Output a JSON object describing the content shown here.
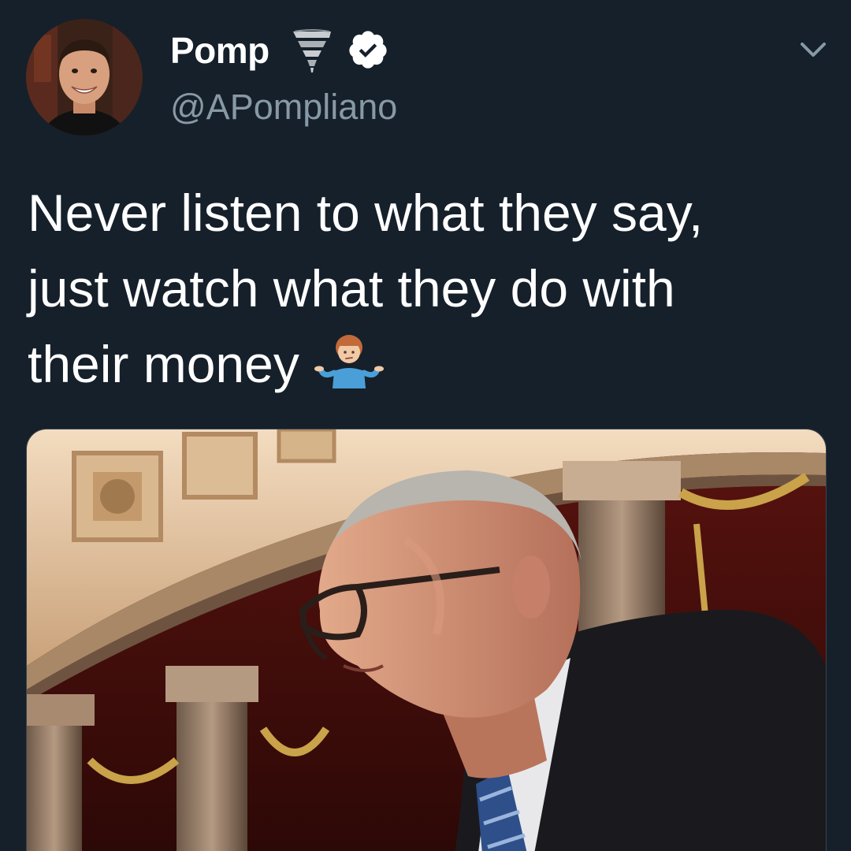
{
  "user": {
    "display_name": "Pomp",
    "handle": "@APompliano",
    "avatar_icon": "profile-photo",
    "badge_icons": [
      "tornado-icon",
      "verified-badge-icon"
    ]
  },
  "menu": {
    "caret_icon": "chevron-down-icon"
  },
  "tweet": {
    "lines": [
      "Never listen to what they say,",
      "just watch what they do with",
      "their money"
    ],
    "emoji_icon": "man-shrugging-icon"
  },
  "media": {
    "icon": "photo-of-man-in-glasses-capitol-rotunda"
  },
  "colors": {
    "background": "#15202b",
    "text": "#ffffff",
    "secondary_text": "#8899a6",
    "verified_badge": "#ffffff",
    "border": "#38444d"
  }
}
